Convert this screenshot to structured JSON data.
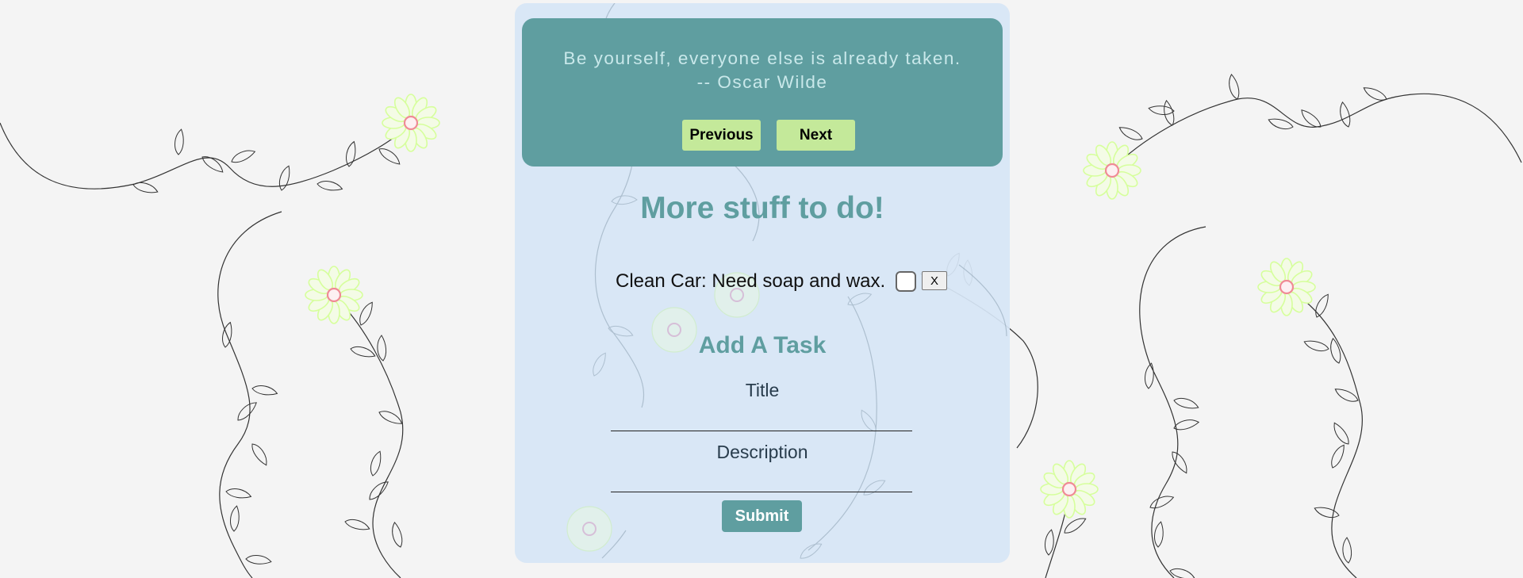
{
  "quote": {
    "text": "Be yourself, everyone else is already taken.",
    "author": "-- Oscar Wilde",
    "previous_label": "Previous",
    "next_label": "Next"
  },
  "main": {
    "title": "More stuff to do!",
    "tasks": [
      {
        "text": "Clean Car: Need soap and wax.",
        "done": false,
        "delete_label": "X"
      }
    ]
  },
  "form": {
    "title": "Add A Task",
    "title_label": "Title",
    "title_value": "",
    "description_label": "Description",
    "description_value": "",
    "submit_label": "Submit"
  },
  "colors": {
    "background": "#f4f4f4",
    "panel": "#d6e5f5",
    "accent": "#5f9ea0",
    "quote_button": "#c4e99a",
    "flower_petal": "#dcffb8",
    "flower_center": "#f08a96"
  },
  "icons": {
    "decor": "vine-flower-icon"
  }
}
